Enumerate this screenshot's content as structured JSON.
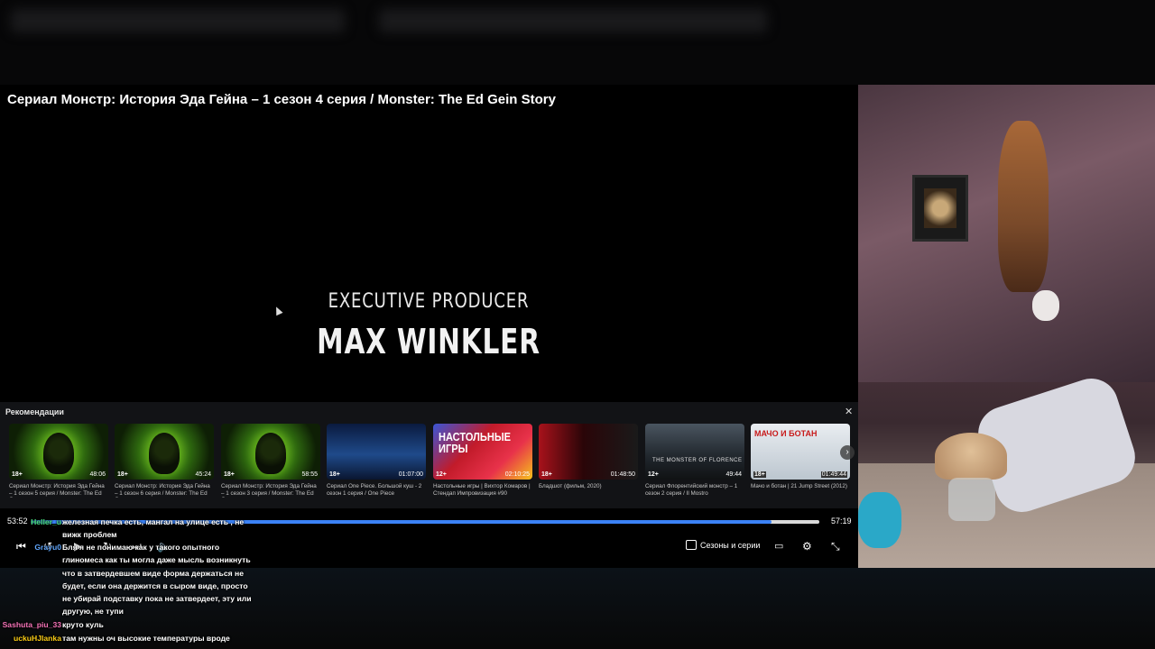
{
  "video": {
    "title": "Сериал Монстр: История Эда Гейна – 1 сезон 4 серия / Monster: The Ed Gein Story",
    "credit_role": "EXECUTIVE PRODUCER",
    "credit_name": "MAX WINKLER"
  },
  "recommendations": {
    "heading": "Рекомендации",
    "close_icon": "close-icon",
    "next_icon": "chevron-right-icon",
    "items": [
      {
        "age": "18+",
        "duration": "48:06",
        "title": "Сериал Монстр: История Эда Гейна – 1 сезон 5 серия / Monster: The Ed Ge..."
      },
      {
        "age": "18+",
        "duration": "45:24",
        "title": "Сериал Монстр: История Эда Гейна – 1 сезон 6 серия / Monster: The Ed Ge..."
      },
      {
        "age": "18+",
        "duration": "58:55",
        "title": "Сериал Монстр: История Эда Гейна – 1 сезон 3 серия / Monster: The Ed Ge..."
      },
      {
        "age": "18+",
        "duration": "01:07:00",
        "title": "Сериал One Piece. Большой куш - 2 сезон 1 серия / One Piece"
      },
      {
        "age": "12+",
        "duration": "02:10:25",
        "title": "Настольные игры | Вихтор Комаров | Стендап Импровизация #90",
        "thumb_text": "НАСТОЛЬНЫЕ ИГРЫ"
      },
      {
        "age": "18+",
        "duration": "01:48:50",
        "title": "Бладшот (фильм, 2020)"
      },
      {
        "age": "12+",
        "duration": "49:44",
        "title": "Сериал Флорентийский монстр – 1 сезон 2 серия / Il Mostro",
        "thumb_text": "THE MONSTER OF FLORENCE"
      },
      {
        "age": "18+",
        "duration": "01:49:44",
        "title": "Мачо и ботан | 21 Jump Street (2012)",
        "thumb_text": "МАЧО И БОТАН"
      }
    ]
  },
  "player": {
    "current_time": "53:52",
    "total_time": "57:19",
    "progress_percent": 93.9,
    "seasons_label": "Сезоны и серии",
    "icons": [
      "skip-back-icon",
      "rewind-icon",
      "play-icon",
      "forward-icon",
      "volume-icon",
      "episodes-icon",
      "subtitles-icon",
      "settings-icon",
      "fullscreen-exit-icon"
    ]
  },
  "chat": [
    {
      "user": "Heller_u",
      "color": "#4ade80",
      "text": "железная печка есть, мангал на улице есть , не вижк проблем"
    },
    {
      "user": "Grayu0",
      "color": "#60a5fa",
      "text": "Бля я не понимаю как у такого опытного глиномеса как ты могла даже мысль возникнуть что в затвердевшем виде форма держаться не будет, если она держится в сыром виде, просто не убирай подставку пока не затвердеет, эту или другую, не тупи"
    },
    {
      "user": "Sashuta_piu_33",
      "color": "#f472b6",
      "text": "круто куль"
    },
    {
      "user": "uckuHJlanka",
      "color": "#facc15",
      "text": "там нужны оч высокие температуры вроде"
    }
  ]
}
